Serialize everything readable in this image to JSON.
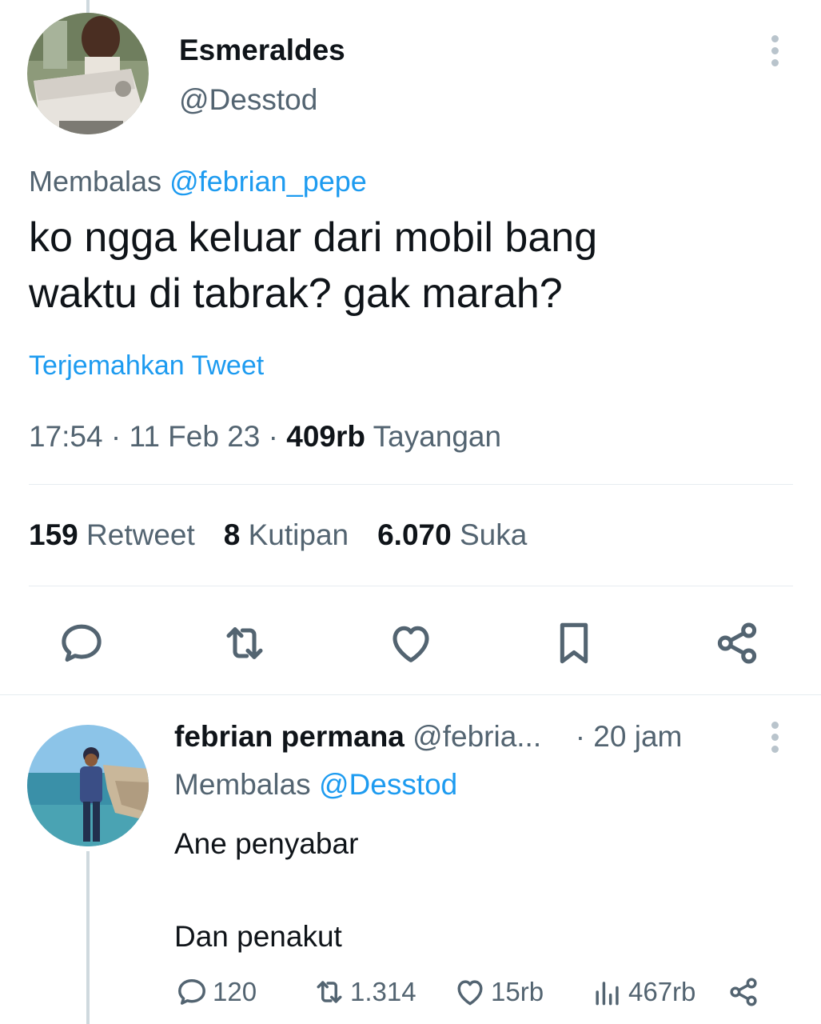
{
  "main_tweet": {
    "display_name": "Esmeraldes",
    "handle": "@Desstod",
    "replying_prefix": "Membalas",
    "replying_to": "@febrian_pepe",
    "text_line1": "ko ngga keluar dari mobil bang",
    "text_line2": "waktu di tabrak? gak marah?",
    "translate_label": "Terjemahkan Tweet",
    "time": "17:54",
    "date": "11 Feb 23",
    "views_count": "409rb",
    "views_label": "Tayangan",
    "separator": "·",
    "stats": {
      "retweets_count": "159",
      "retweets_label": "Retweet",
      "quotes_count": "8",
      "quotes_label": "Kutipan",
      "likes_count": "6.070",
      "likes_label": "Suka"
    },
    "actions": [
      "reply-icon",
      "retweet-icon",
      "like-icon",
      "bookmark-icon",
      "share-icon"
    ]
  },
  "reply": {
    "display_name": "febrian permana",
    "handle": "@febria...",
    "time": "· 20 jam",
    "replying_prefix": "Membalas",
    "replying_to": "@Desstod",
    "text_line1": "Ane penyabar",
    "text_line2": "Dan penakut",
    "counts": {
      "replies": "120",
      "retweets": "1.314",
      "likes": "15rb",
      "views": "467rb"
    }
  },
  "colors": {
    "accent": "#1d9bf0",
    "text_primary": "#0f1419",
    "text_secondary": "#536471",
    "divider": "#e6ecf0",
    "thread_line": "#cfd9de"
  }
}
